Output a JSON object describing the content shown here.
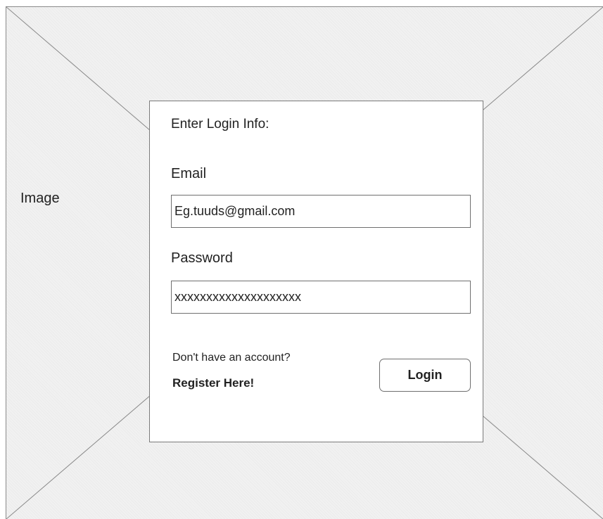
{
  "background_image": {
    "label": "Image"
  },
  "login_form": {
    "heading": "Enter Login Info:",
    "email": {
      "label": "Email",
      "value": "Eg.tuuds@gmail.com"
    },
    "password": {
      "label": "Password",
      "value": "xxxxxxxxxxxxxxxxxxxx"
    },
    "register_prompt": "Don't have an account?",
    "register_link": "Register Here!",
    "login_button": "Login"
  },
  "colors": {
    "border": "#7a7a7a",
    "placeholder_fill": "#f1f1f1",
    "text": "#222222"
  }
}
